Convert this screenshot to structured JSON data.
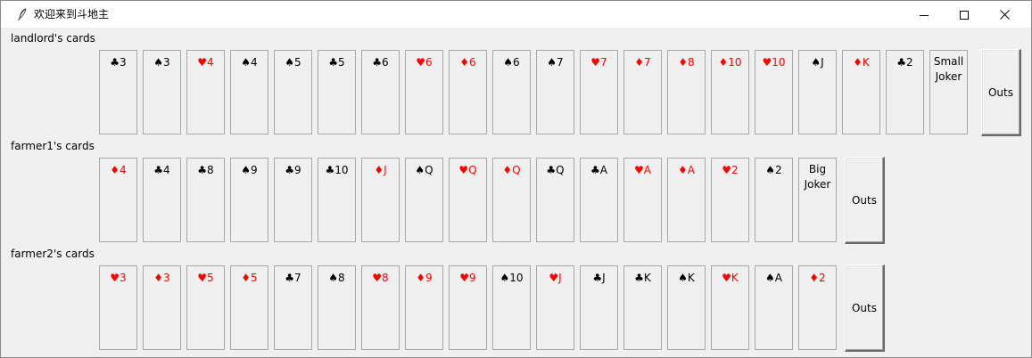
{
  "window": {
    "title": "欢迎来到斗地主",
    "minimize_icon": "minimize-icon",
    "maximize_icon": "maximize-icon",
    "close_icon": "close-icon"
  },
  "colors": {
    "red_suit": "#ff0000",
    "black_suit": "#000000",
    "background": "#f0f0f0"
  },
  "rows": [
    {
      "label": "landlord's cards",
      "cards": [
        {
          "text": "♣3",
          "color": "black"
        },
        {
          "text": "♠3",
          "color": "black"
        },
        {
          "text": "♥4",
          "color": "red"
        },
        {
          "text": "♠4",
          "color": "black"
        },
        {
          "text": "♠5",
          "color": "black"
        },
        {
          "text": "♣5",
          "color": "black"
        },
        {
          "text": "♣6",
          "color": "black"
        },
        {
          "text": "♥6",
          "color": "red"
        },
        {
          "text": "♦6",
          "color": "red"
        },
        {
          "text": "♠6",
          "color": "black"
        },
        {
          "text": "♠7",
          "color": "black"
        },
        {
          "text": "♥7",
          "color": "red"
        },
        {
          "text": "♦7",
          "color": "red"
        },
        {
          "text": "♦8",
          "color": "red"
        },
        {
          "text": "♦10",
          "color": "red"
        },
        {
          "text": "♥10",
          "color": "red"
        },
        {
          "text": "♠J",
          "color": "black"
        },
        {
          "text": "♦K",
          "color": "red"
        },
        {
          "text": "♣2",
          "color": "black"
        },
        {
          "text": "Small\nJoker",
          "color": "joker"
        }
      ],
      "outs_label": "Outs"
    },
    {
      "label": "farmer1's cards",
      "cards": [
        {
          "text": "♦4",
          "color": "red"
        },
        {
          "text": "♣4",
          "color": "black"
        },
        {
          "text": "♣8",
          "color": "black"
        },
        {
          "text": "♠9",
          "color": "black"
        },
        {
          "text": "♣9",
          "color": "black"
        },
        {
          "text": "♣10",
          "color": "black"
        },
        {
          "text": "♦J",
          "color": "red"
        },
        {
          "text": "♠Q",
          "color": "black"
        },
        {
          "text": "♥Q",
          "color": "red"
        },
        {
          "text": "♦Q",
          "color": "red"
        },
        {
          "text": "♣Q",
          "color": "black"
        },
        {
          "text": "♣A",
          "color": "black"
        },
        {
          "text": "♥A",
          "color": "red"
        },
        {
          "text": "♦A",
          "color": "red"
        },
        {
          "text": "♥2",
          "color": "red"
        },
        {
          "text": "♠2",
          "color": "black"
        },
        {
          "text": "Big\nJoker",
          "color": "joker"
        }
      ],
      "outs_label": "Outs"
    },
    {
      "label": "farmer2's cards",
      "cards": [
        {
          "text": "♥3",
          "color": "red"
        },
        {
          "text": "♦3",
          "color": "red"
        },
        {
          "text": "♥5",
          "color": "red"
        },
        {
          "text": "♦5",
          "color": "red"
        },
        {
          "text": "♣7",
          "color": "black"
        },
        {
          "text": "♠8",
          "color": "black"
        },
        {
          "text": "♥8",
          "color": "red"
        },
        {
          "text": "♦9",
          "color": "red"
        },
        {
          "text": "♥9",
          "color": "red"
        },
        {
          "text": "♠10",
          "color": "black"
        },
        {
          "text": "♥J",
          "color": "red"
        },
        {
          "text": "♣J",
          "color": "black"
        },
        {
          "text": "♣K",
          "color": "black"
        },
        {
          "text": "♠K",
          "color": "black"
        },
        {
          "text": "♥K",
          "color": "red"
        },
        {
          "text": "♠A",
          "color": "black"
        },
        {
          "text": "♦2",
          "color": "red"
        }
      ],
      "outs_label": "Outs"
    }
  ]
}
